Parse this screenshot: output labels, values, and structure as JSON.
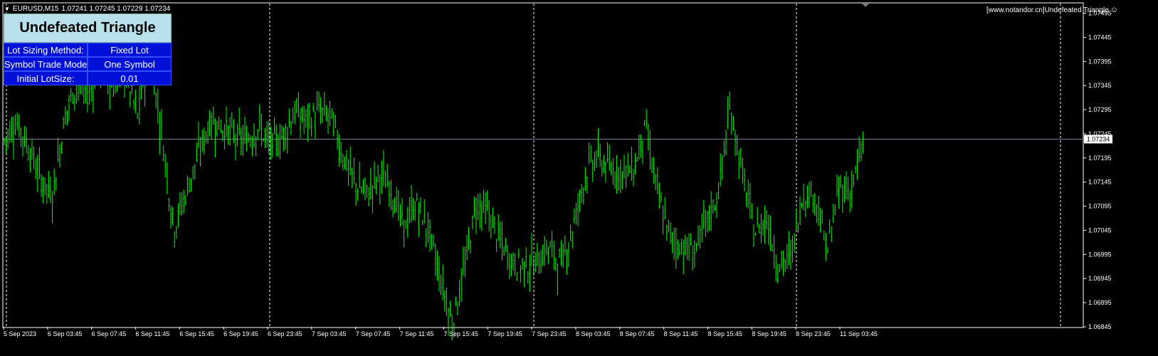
{
  "header": {
    "collapse_glyph": "▼",
    "symbol": "EURUSD,M15",
    "ohlc": "1.07241 1.07245 1.07229 1.07234"
  },
  "watermark": {
    "text": "[www.notandor.cn]Undefeated Triangle",
    "icon": "smiley-icon"
  },
  "panel": {
    "title": "Undefeated Triangle",
    "rows": [
      {
        "label": "Lot Sizing Method:",
        "value": "Fixed Lot"
      },
      {
        "label": "Symbol Trade Mode",
        "value": "One Symbol"
      },
      {
        "label": "Initial LotSize:",
        "value": "0.01"
      }
    ]
  },
  "colors": {
    "candles": "#00ff00",
    "background": "#000000",
    "bid_line": "#778899",
    "panel_title_bg": "#b8e0ea",
    "panel_row_bg": "#0010d8"
  },
  "chart_data": {
    "type": "line",
    "symbol": "EURUSD",
    "timeframe": "M15",
    "y_ticks": [
      "1.07495",
      "1.07445",
      "1.07395",
      "1.07345",
      "1.07295",
      "1.07245",
      "1.07195",
      "1.07145",
      "1.07095",
      "1.07045",
      "1.06995",
      "1.06945",
      "1.06895",
      "1.06845"
    ],
    "ylim": [
      1.06845,
      1.07515
    ],
    "current_price": "1.07234",
    "x_ticks": [
      "5 Sep 2023",
      "6 Sep 03:45",
      "6 Sep 07:45",
      "6 Sep 11:45",
      "6 Sep 15:45",
      "6 Sep 19:45",
      "6 Sep 23:45",
      "7 Sep 03:45",
      "7 Sep 07:45",
      "7 Sep 11:45",
      "7 Sep 15:45",
      "7 Sep 19:45",
      "7 Sep 23:45",
      "8 Sep 03:45",
      "8 Sep 07:45",
      "8 Sep 11:45",
      "8 Sep 15:45",
      "8 Sep 19:45",
      "8 Sep 23:45",
      "11 Sep 03:45"
    ],
    "series": [
      {
        "values": [
          1.0723,
          1.0727,
          1.0722,
          1.0715,
          1.0712,
          1.0728,
          1.0735,
          1.0733,
          1.0738,
          1.0734,
          1.0737,
          1.0728,
          1.0741,
          1.0725,
          1.0705,
          1.0712,
          1.072,
          1.0727,
          1.0726,
          1.0724,
          1.0723,
          1.0726,
          1.0722,
          1.0724,
          1.0729,
          1.0727,
          1.0729,
          1.0728,
          1.072,
          1.0714,
          1.0712,
          1.0716,
          1.0713,
          1.0705,
          1.071,
          1.0705,
          1.0695,
          1.0685,
          1.0696,
          1.071,
          1.0708,
          1.0702,
          1.0698,
          1.0697,
          1.0698,
          1.0701,
          1.0697,
          1.0705,
          1.0716,
          1.072,
          1.0717,
          1.0717,
          1.0717,
          1.0726,
          1.0712,
          1.0703,
          1.0701,
          1.07,
          1.0706,
          1.0712,
          1.073,
          1.0716,
          1.0704,
          1.0707,
          1.0697,
          1.0699,
          1.0712,
          1.0712,
          1.07,
          1.0713,
          1.0713,
          1.0722
        ]
      }
    ]
  }
}
